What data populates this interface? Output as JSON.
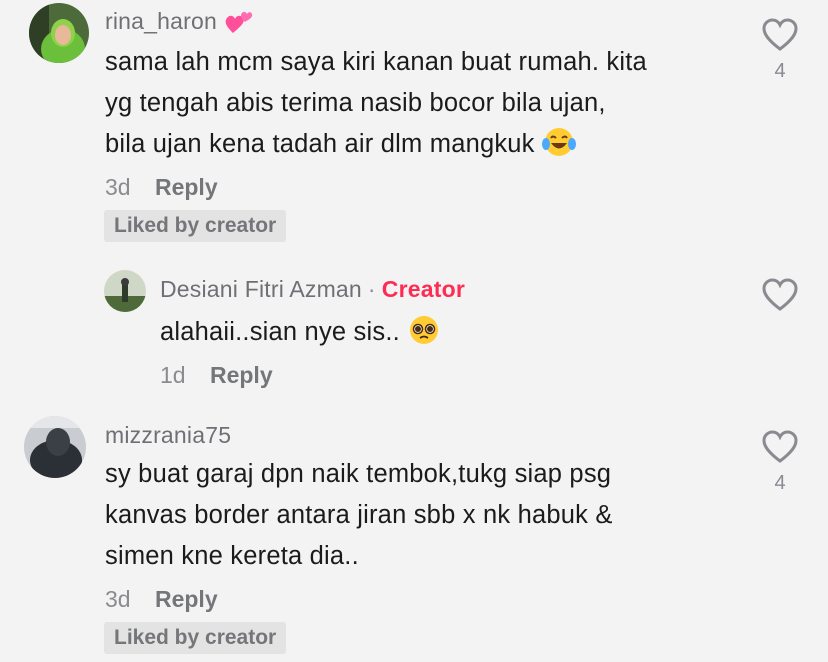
{
  "comments": [
    {
      "username": "rina_haron",
      "text_lines": [
        "sama lah mcm saya kiri kanan buat rumah. kita",
        "yg tengah abis terima nasib bocor bila ujan,",
        "bila ujan kena tadah air dlm mangkuk"
      ],
      "time": "3d",
      "reply_label": "Reply",
      "liked_badge": "Liked by creator",
      "likes": "4"
    },
    {
      "username": "Desiani Fitri Azman",
      "creator_label": "Creator",
      "separator": "·",
      "text": "alahaii..sian nye sis..",
      "time": "1d",
      "reply_label": "Reply"
    },
    {
      "username": "mizzrania75",
      "text_lines": [
        "sy buat garaj dpn naik tembok,tukg siap psg",
        "kanvas border antara jiran sbb x nk habuk &",
        "simen kne kereta dia.."
      ],
      "time": "3d",
      "reply_label": "Reply",
      "liked_badge": "Liked by creator",
      "likes": "4"
    }
  ],
  "icons": {
    "like": "heart-outline-icon",
    "hearts_emoji": "two-hearts-emoji",
    "laugh_emoji": "tears-of-joy-emoji",
    "pleading_emoji": "pleading-face-emoji"
  },
  "colors": {
    "background": "#f3f3f3",
    "creator": "#fe2c55",
    "muted": "#8a8b90"
  }
}
